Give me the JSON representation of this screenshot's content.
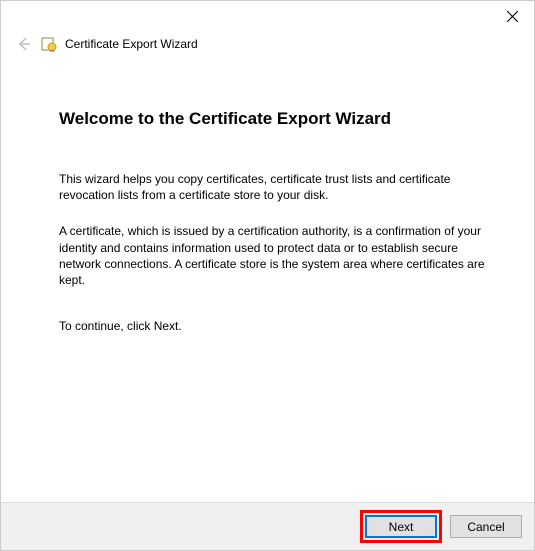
{
  "window": {
    "title": "Certificate Export Wizard"
  },
  "content": {
    "heading": "Welcome to the Certificate Export Wizard",
    "paragraph1": "This wizard helps you copy certificates, certificate trust lists and certificate revocation lists from a certificate store to your disk.",
    "paragraph2": "A certificate, which is issued by a certification authority, is a confirmation of your identity and contains information used to protect data or to establish secure network connections. A certificate store is the system area where certificates are kept.",
    "paragraph3": "To continue, click Next."
  },
  "footer": {
    "next_label": "Next",
    "cancel_label": "Cancel"
  }
}
